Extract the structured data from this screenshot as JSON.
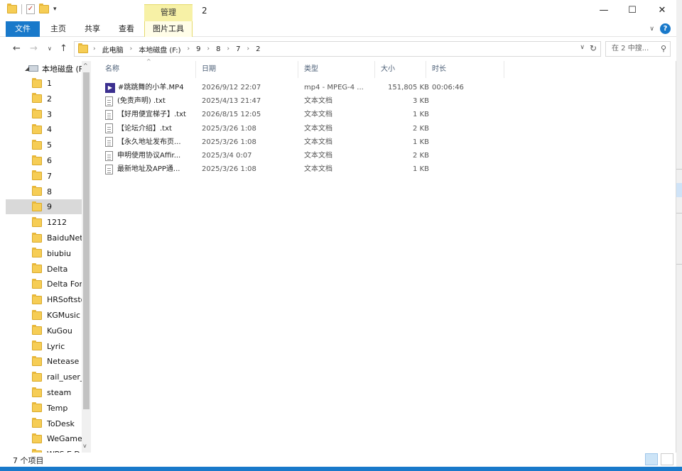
{
  "title": {
    "window_title": "2",
    "context_tab_top": "管理",
    "min_glyph": "—",
    "max_glyph": "☐",
    "close_glyph": "✕"
  },
  "ribbon": {
    "tabs": [
      "文件",
      "主页",
      "共享",
      "查看",
      "图片工具"
    ],
    "collapse_glyph": "∨",
    "help_glyph": "?"
  },
  "address": {
    "back_glyph": "←",
    "forward_glyph": "→",
    "recent_glyph": "∨",
    "up_glyph": "↑",
    "crumbs": [
      "此电脑",
      "本地磁盘 (F:)",
      "9",
      "8",
      "7",
      "2"
    ],
    "crumb_sep": "›",
    "dropdown_glyph": "∨",
    "refresh_glyph": "↻",
    "search_placeholder": "在 2 中搜...",
    "search_glyph": "⚲"
  },
  "nav": {
    "drive_label": "本地磁盘 (F:",
    "drive_expand_glyph": "◢",
    "items": [
      "1",
      "2",
      "3",
      "4",
      "5",
      "6",
      "7",
      "8",
      "9",
      "1212",
      "BaiduNetd",
      "biubiu",
      "Delta",
      "Delta Forc",
      "HRSoftsto",
      "KGMusic",
      "KuGou",
      "Lyric",
      "Netease",
      "rail_user_c",
      "steam",
      "Temp",
      "ToDesk",
      "WeGameA",
      "WPS E D"
    ],
    "selected_index": 8,
    "scroll_up_glyph": "^",
    "scroll_down_glyph": "v"
  },
  "columns": {
    "name": "名称",
    "date": "日期",
    "type": "类型",
    "size": "大小",
    "duration": "时长",
    "sort_glyph": "^"
  },
  "files": [
    {
      "name": "#跳跳舞的小羊.MP4",
      "date": "2026/9/12 22:07",
      "type": "mp4 - MPEG-4 ...",
      "size": "151,805 KB",
      "duration": "00:06:46",
      "icon": "video-icon",
      "icon_glyph": "▶"
    },
    {
      "name": "(免责声明) .txt",
      "date": "2025/4/13 21:47",
      "type": "文本文档",
      "size": "3 KB",
      "duration": "",
      "icon": "text-file-icon"
    },
    {
      "name": "【好用便宜梯子】.txt",
      "date": "2026/8/15 12:05",
      "type": "文本文档",
      "size": "1 KB",
      "duration": "",
      "icon": "text-file-icon"
    },
    {
      "name": "【论坛介绍】.txt",
      "date": "2025/3/26 1:08",
      "type": "文本文档",
      "size": "2 KB",
      "duration": "",
      "icon": "text-file-icon"
    },
    {
      "name": "【永久地址发布页...",
      "date": "2025/3/26 1:08",
      "type": "文本文档",
      "size": "1 KB",
      "duration": "",
      "icon": "text-file-icon"
    },
    {
      "name": "申明使用协议Affir...",
      "date": "2025/3/4 0:07",
      "type": "文本文档",
      "size": "2 KB",
      "duration": "",
      "icon": "text-file-icon"
    },
    {
      "name": "最新地址及APP通...",
      "date": "2025/3/26 1:08",
      "type": "文本文档",
      "size": "1 KB",
      "duration": "",
      "icon": "text-file-icon"
    }
  ],
  "status": {
    "count": "7 个项目"
  },
  "colors": {
    "accent": "#1979ca",
    "manage_tab": "#f7f1a6",
    "folder": "#f6cd55",
    "selected": "#d9d9d9"
  }
}
